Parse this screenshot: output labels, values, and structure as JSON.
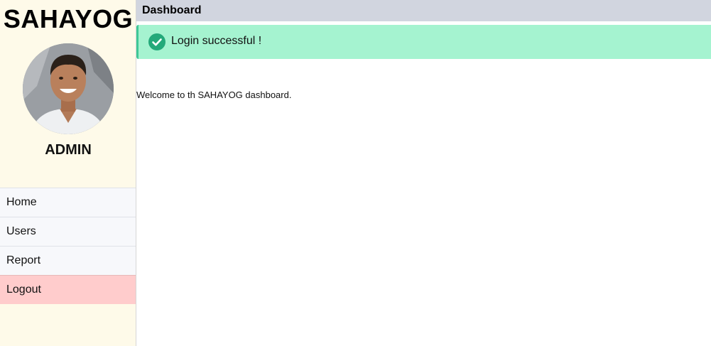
{
  "sidebar": {
    "brand": "SAHAYOG",
    "role": "ADMIN",
    "avatar_icon": "user-avatar-photo",
    "items": [
      {
        "label": "Home"
      },
      {
        "label": "Users"
      },
      {
        "label": "Report"
      },
      {
        "label": "Logout"
      }
    ]
  },
  "header": {
    "title": "Dashboard"
  },
  "alert": {
    "icon": "check-circle-icon",
    "message": "Login successful !",
    "color": "#a5f3d0",
    "accent": "#3fc896"
  },
  "main": {
    "welcome": "Welcome to th SAHAYOG dashboard."
  },
  "colors": {
    "sidebar_bg": "#fefae9",
    "topbar_bg": "#d1d5df",
    "logout_bg": "#ffcccc"
  }
}
